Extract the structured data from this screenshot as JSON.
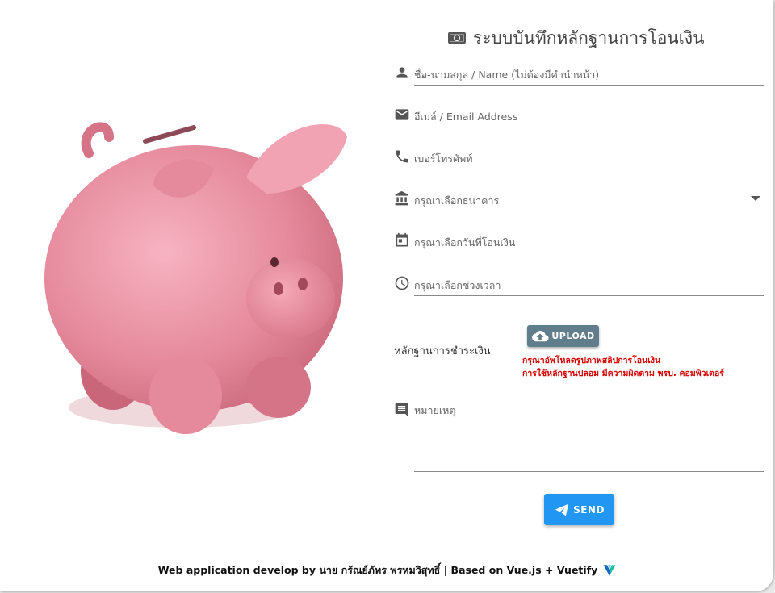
{
  "form": {
    "title": "ระบบบันทึกหลักฐานการโอนเงิน",
    "title_icon": "money-icon",
    "fields": [
      {
        "name": "name",
        "icon": "person-icon",
        "placeholder": "ชื่อ-นามสกุล / Name (ไม่ต้องมีคำนำหน้า)"
      },
      {
        "name": "email",
        "icon": "email-icon",
        "placeholder": "อีเมล์ / Email Address"
      },
      {
        "name": "phone",
        "icon": "phone-icon",
        "placeholder": "เบอร์โทรศัพท์"
      },
      {
        "name": "bank",
        "icon": "bank-icon",
        "placeholder": "กรุณาเลือกธนาคาร"
      },
      {
        "name": "date",
        "icon": "calendar-icon",
        "placeholder": "กรุณาเลือกวันที่โอนเงิน"
      },
      {
        "name": "time",
        "icon": "clock-icon",
        "placeholder": "กรุณาเลือกช่วงเวลา"
      }
    ],
    "proof_label": "หลักฐานการชำระเงิน",
    "upload_label": "UPLOAD",
    "upload_hint": "กรุณาอัพโหลดรูปภาพสลิปการโอนเงิน",
    "upload_warning": "การใช้หลักฐานปลอม มีความผิดตาม พรบ. คอมพิวเตอร์",
    "note_placeholder": "หมายเหตุ",
    "send_label": "SEND"
  },
  "footer": {
    "text": "Web application develop by นาย กรัณย์ภัทร พรหมวิสุทธิ์ | Based on Vue.js + Vuetify",
    "icon": "vuetify-logo-icon"
  },
  "colors": {
    "upload_button": "#607d8b",
    "send_button": "#2196f3",
    "warning_text": "#d50000",
    "pig": "#e58a9c"
  }
}
